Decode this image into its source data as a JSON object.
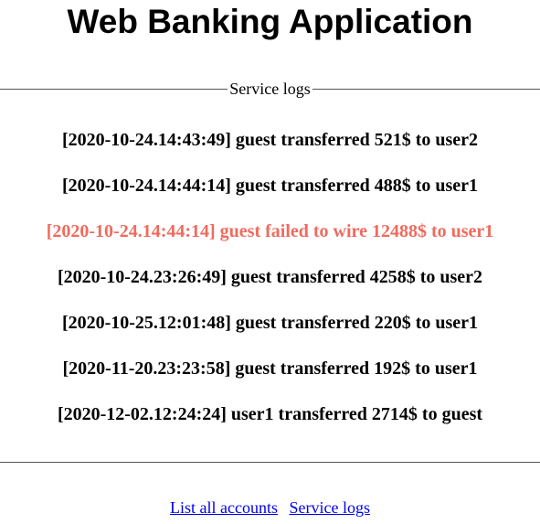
{
  "header": {
    "title": "Web Banking Application"
  },
  "section": {
    "legend": "Service logs"
  },
  "logs": [
    {
      "text": "[2020-10-24.14:43:49] guest transferred 521$ to user2",
      "status": "ok"
    },
    {
      "text": "[2020-10-24.14:44:14] guest transferred 488$ to user1",
      "status": "ok"
    },
    {
      "text": "[2020-10-24.14:44:14] guest failed to wire 12488$ to user1",
      "status": "failed"
    },
    {
      "text": "[2020-10-24.23:26:49] guest transferred 4258$ to user2",
      "status": "ok"
    },
    {
      "text": "[2020-10-25.12:01:48] guest transferred 220$ to user1",
      "status": "ok"
    },
    {
      "text": "[2020-11-20.23:23:58] guest transferred 192$ to user1",
      "status": "ok"
    },
    {
      "text": "[2020-12-02.12:24:24] user1 transferred 2714$ to guest",
      "status": "ok"
    }
  ],
  "colors": {
    "failed": "#ef6b5e",
    "link": "#0000ee"
  },
  "footer": {
    "links": [
      {
        "label": "List all accounts"
      },
      {
        "label": "Service logs"
      }
    ]
  }
}
